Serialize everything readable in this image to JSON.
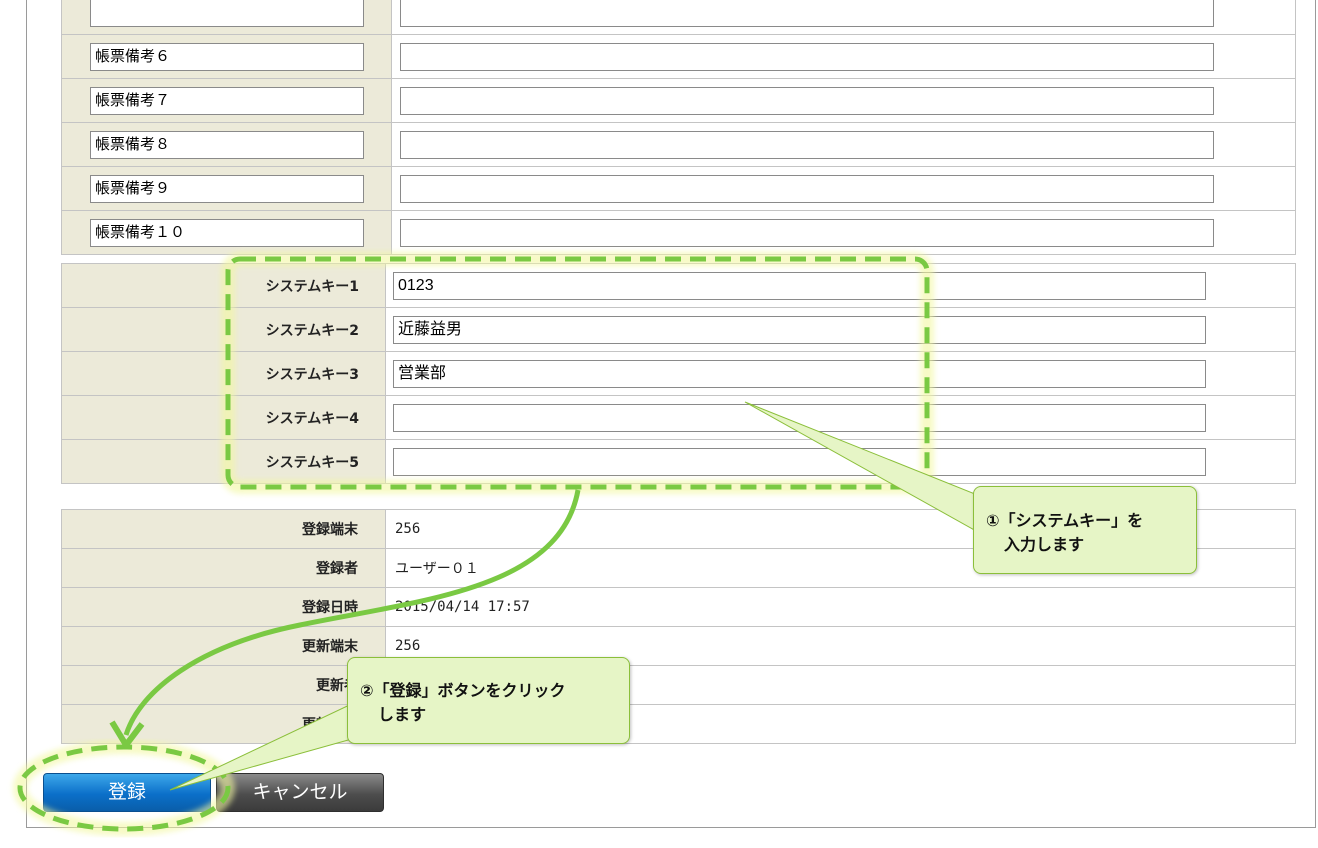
{
  "biko_rows": [
    {
      "label": ""
    },
    {
      "label": "帳票備考６"
    },
    {
      "label": "帳票備考７"
    },
    {
      "label": "帳票備考８"
    },
    {
      "label": "帳票備考９"
    },
    {
      "label": "帳票備考１０"
    }
  ],
  "system_keys": [
    {
      "label": "システムキー1",
      "value": "0123"
    },
    {
      "label": "システムキー2",
      "value": "近藤益男"
    },
    {
      "label": "システムキー3",
      "value": "営業部"
    },
    {
      "label": "システムキー4",
      "value": ""
    },
    {
      "label": "システムキー5",
      "value": ""
    }
  ],
  "meta": [
    {
      "label": "登録端末",
      "value": "256"
    },
    {
      "label": "登録者",
      "value": "ユーザー０１"
    },
    {
      "label": "登録日時",
      "value": "2015/04/14 17:57"
    },
    {
      "label": "更新端末",
      "value": "256"
    },
    {
      "label": "更新者",
      "value": ""
    },
    {
      "label": "更新日時",
      "value": ""
    }
  ],
  "buttons": {
    "register": "登録",
    "cancel": "キャンセル"
  },
  "callouts": {
    "step1_line1": "①「システムキー」を",
    "step1_line2": "入力します",
    "step2_line1": "②「登録」ボタンをクリック",
    "step2_line2": "します"
  },
  "colors": {
    "highlight": "#7ac943",
    "callout_bg": "#e6f5c6",
    "register_button": "#0b6fc9",
    "cancel_button": "#4d4d4d",
    "label_bg": "#ecead9"
  }
}
